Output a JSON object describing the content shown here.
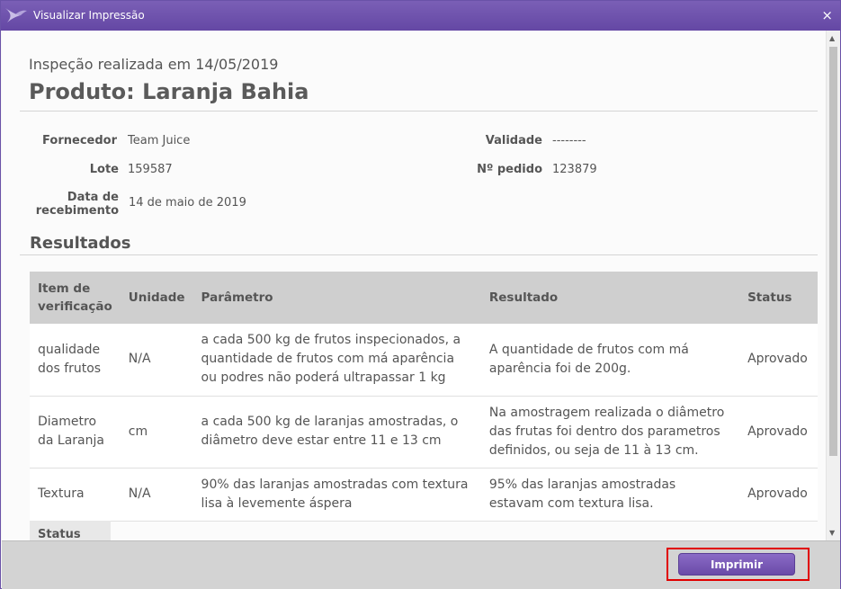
{
  "window": {
    "title": "Visualizar Impressão",
    "close_glyph": "×",
    "logo_icon": "swallow-logo-icon"
  },
  "header": {
    "subtitle": "Inspeção realizada em 14/05/2019",
    "product": "Produto: Laranja Bahia"
  },
  "info": {
    "fornecedor_label": "Fornecedor",
    "fornecedor_value": "Team Juice",
    "lote_label": "Lote",
    "lote_value": "159587",
    "data_label_1": "Data de",
    "data_label_2": "recebimento",
    "data_value": "14 de maio de 2019",
    "validade_label": "Validade",
    "validade_value": "--------",
    "pedido_label": "Nº pedido",
    "pedido_value": "123879"
  },
  "results": {
    "section_title": "Resultados",
    "headers": {
      "item": [
        "Item de",
        "verificação"
      ],
      "unidade": "Unidade",
      "parametro": "Parâmetro",
      "resultado": "Resultado",
      "status": "Status"
    },
    "rows": [
      {
        "item": "qualidade dos frutos",
        "unidade": "N/A",
        "parametro": "a cada 500 kg de frutos inspecionados, a quantidade de frutos com má aparência ou podres não poderá ultrapassar 1 kg",
        "resultado": "A quantidade de frutos com má aparência foi de 200g.",
        "status": "Aprovado"
      },
      {
        "item": "Diametro da Laranja",
        "unidade": "cm",
        "parametro": "a cada 500 kg de laranjas amostradas, o diâmetro deve estar entre 11 e 13 cm",
        "resultado": "Na amostragem realizada o diâmetro das frutas foi dentro dos parametros definidos, ou seja de 11 à 13 cm.",
        "status": "Aprovado"
      },
      {
        "item": "Textura",
        "unidade": "N/A",
        "parametro": "90% das laranjas amostradas com textura lisa à levemente áspera",
        "resultado": "95% das laranjas amostradas estavam com textura lisa.",
        "status": "Aprovado"
      }
    ],
    "partial_row_label": "Status"
  },
  "footer": {
    "print_label": "Imprimir"
  },
  "colors": {
    "titlebar": "#6a4fa8",
    "print_button": "#7a5cb8",
    "highlight": "#e00000"
  }
}
